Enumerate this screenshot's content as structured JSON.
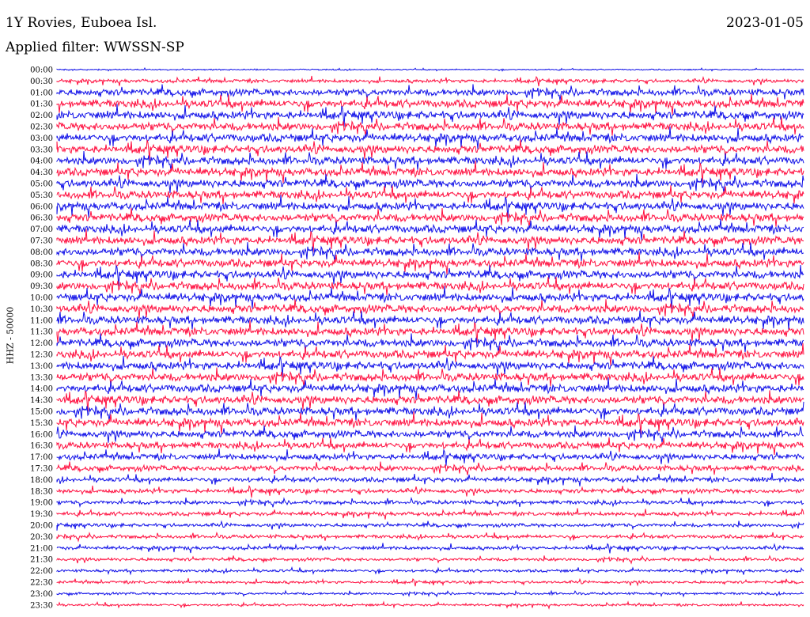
{
  "header": {
    "station": "1Y Rovies, Euboea Isl.",
    "filter": "Applied filter: WWSSN-SP",
    "date": "2023-01-05",
    "channel": "HHZ - 50000"
  },
  "colors": {
    "trace_a": "#1010e8",
    "trace_b": "#ff1040",
    "background": "#ffffff",
    "text": "#000000"
  },
  "chart_data": {
    "type": "line",
    "title": "1Y Rovies, Euboea Isl.",
    "subtitle": "Applied filter: WWSSN-SP",
    "ylabel": "HHZ - 50000",
    "date": "2023-01-05",
    "trace_colors": [
      "#1010e8",
      "#ff1040"
    ],
    "row_labels": [
      "00:00",
      "00:30",
      "01:00",
      "01:30",
      "02:00",
      "02:30",
      "03:00",
      "03:30",
      "04:00",
      "04:30",
      "05:00",
      "05:30",
      "06:00",
      "06:30",
      "07:00",
      "07:30",
      "08:00",
      "08:30",
      "09:00",
      "09:30",
      "10:00",
      "10:30",
      "11:00",
      "11:30",
      "12:00",
      "12:30",
      "13:00",
      "13:30",
      "14:00",
      "14:30",
      "15:00",
      "15:30",
      "16:00",
      "16:30",
      "17:00",
      "17:30",
      "18:00",
      "18:30",
      "19:00",
      "19:30",
      "20:00",
      "20:30",
      "21:00",
      "21:30",
      "22:00",
      "22:30",
      "23:00",
      "23:30"
    ],
    "row_amplitude_relative": [
      0.15,
      0.45,
      0.85,
      1.0,
      1.0,
      1.0,
      1.0,
      1.0,
      1.0,
      1.0,
      1.0,
      1.0,
      1.0,
      1.0,
      1.0,
      1.0,
      1.0,
      1.0,
      1.0,
      1.0,
      1.0,
      1.0,
      1.0,
      1.0,
      1.0,
      1.0,
      1.0,
      1.0,
      1.0,
      1.0,
      1.0,
      1.0,
      0.9,
      0.85,
      0.75,
      0.7,
      0.6,
      0.55,
      0.5,
      0.5,
      0.45,
      0.45,
      0.45,
      0.4,
      0.35,
      0.35,
      0.3,
      0.3
    ],
    "grid": false,
    "legend": "none"
  }
}
